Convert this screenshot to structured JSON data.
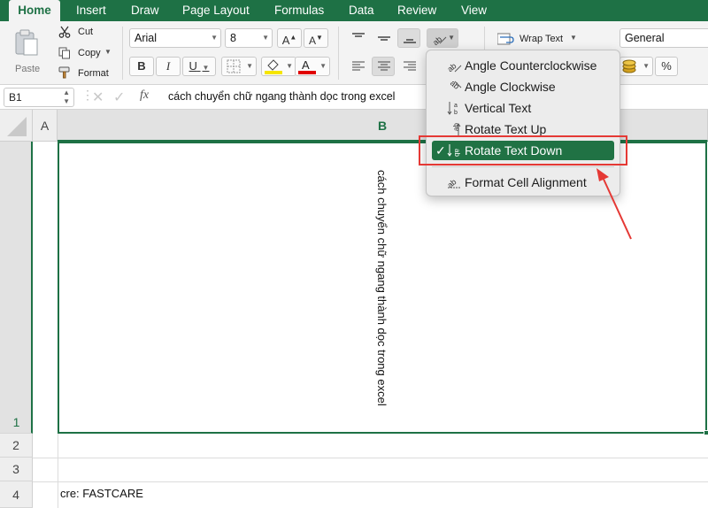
{
  "tabs": [
    "Home",
    "Insert",
    "Draw",
    "Page Layout",
    "Formulas",
    "Data",
    "Review",
    "View"
  ],
  "clipboard": {
    "paste": "Paste",
    "cut": "Cut",
    "copy": "Copy",
    "format": "Format"
  },
  "font": {
    "name": "Arial",
    "size": "8",
    "bold": "B",
    "italic": "I",
    "underline": "U"
  },
  "alignment": {
    "wrap_text": "Wrap Text",
    "number_format": "General",
    "percent": "%"
  },
  "formula_bar": {
    "cell_ref": "B1",
    "fx": "fx",
    "value": "cách chuyển chữ ngang thành dọc trong excel"
  },
  "columns": [
    "A",
    "B"
  ],
  "rows": [
    "1",
    "2",
    "3",
    "4"
  ],
  "cells": {
    "B1": "cách chuyển chữ ngang thành dọc trong excel",
    "A4": "cre: FASTCARE"
  },
  "orientation_menu": {
    "items": [
      "Angle Counterclockwise",
      "Angle Clockwise",
      "Vertical Text",
      "Rotate Text Up",
      "Rotate Text Down"
    ],
    "checked_item": "Rotate Text Down",
    "format_alignment": "Format Cell Alignment"
  },
  "colors": {
    "accent": "#1e7145",
    "highlight": "#207244",
    "annotation": "#e53935"
  }
}
